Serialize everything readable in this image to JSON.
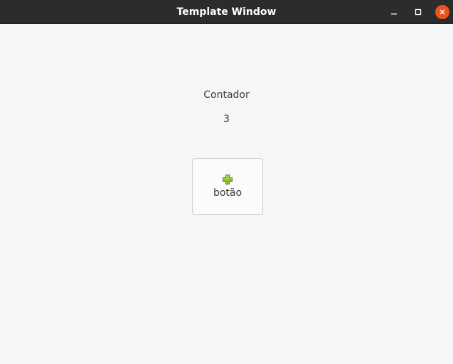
{
  "window": {
    "title": "Template Window",
    "controls": {
      "minimize": "minimize-icon",
      "maximize": "maximize-icon",
      "close": "close-icon"
    },
    "accent_color": "#e95420"
  },
  "main": {
    "counter_label": "Contador",
    "counter_value": "3",
    "button": {
      "label": "botão",
      "icon": "plus-icon",
      "icon_color": "#8bbd2a"
    }
  }
}
